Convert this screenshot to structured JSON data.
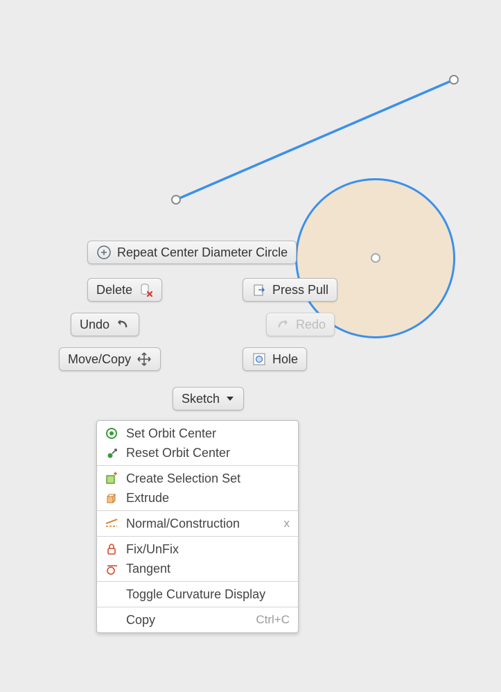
{
  "colors": {
    "sketch_stroke": "#3b90ea",
    "sketch_fill": "#f2e3cf"
  },
  "toolbar": {
    "repeat_label": "Repeat Center Diameter Circle",
    "delete_label": "Delete",
    "press_pull_label": "Press Pull",
    "undo_label": "Undo",
    "redo_label": "Redo",
    "move_copy_label": "Move/Copy",
    "hole_label": "Hole",
    "sketch_label": "Sketch"
  },
  "context_menu": {
    "items": [
      {
        "label": "Set Orbit Center"
      },
      {
        "label": "Reset Orbit Center"
      },
      {
        "sep": true
      },
      {
        "label": "Create Selection Set"
      },
      {
        "label": "Extrude"
      },
      {
        "sep": true
      },
      {
        "label": "Normal/Construction",
        "accel": "x"
      },
      {
        "sep": true
      },
      {
        "label": "Fix/UnFix"
      },
      {
        "label": "Tangent"
      },
      {
        "sep": true
      },
      {
        "label": "Toggle Curvature Display"
      },
      {
        "sep": true
      },
      {
        "label": "Copy",
        "accel": "Ctrl+C"
      }
    ]
  }
}
